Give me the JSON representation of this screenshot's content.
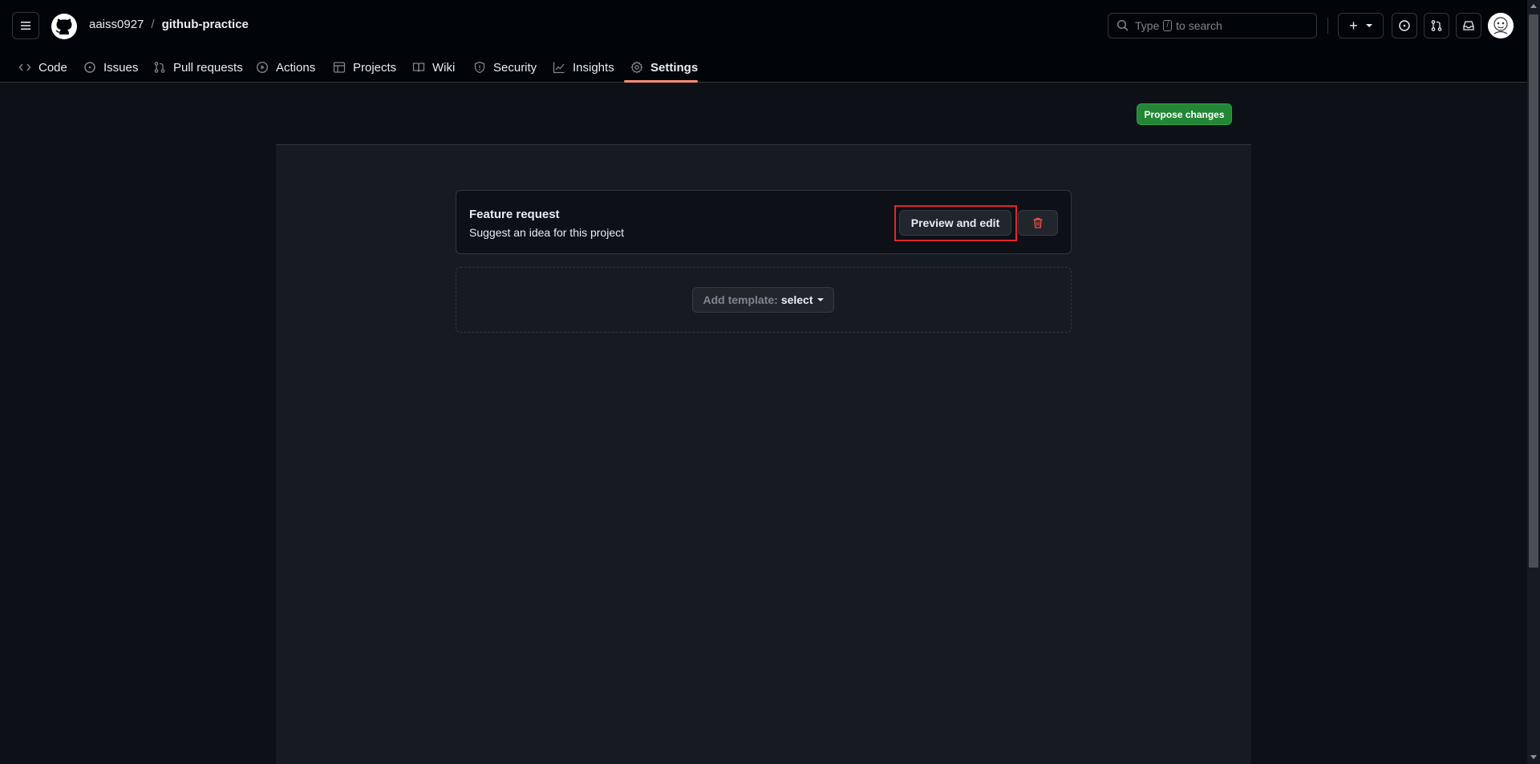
{
  "header": {
    "owner": "aaiss0927",
    "separator": "/",
    "repo": "github-practice",
    "search_before": "Type",
    "search_key": "/",
    "search_after": "to search",
    "create_label": "+"
  },
  "tabs": [
    {
      "label": "Code",
      "icon": "code-icon"
    },
    {
      "label": "Issues",
      "icon": "issue-opened-icon"
    },
    {
      "label": "Pull requests",
      "icon": "git-pull-request-icon"
    },
    {
      "label": "Actions",
      "icon": "play-icon"
    },
    {
      "label": "Projects",
      "icon": "table-icon"
    },
    {
      "label": "Wiki",
      "icon": "book-icon"
    },
    {
      "label": "Security",
      "icon": "shield-icon"
    },
    {
      "label": "Insights",
      "icon": "graph-icon"
    },
    {
      "label": "Settings",
      "icon": "gear-icon",
      "active": true
    }
  ],
  "main": {
    "propose_label": "Propose changes",
    "template": {
      "title": "Feature request",
      "description": "Suggest an idea for this project",
      "preview_label": "Preview and edit"
    },
    "add_template": {
      "label": "Add template:",
      "value": "select"
    }
  },
  "colors": {
    "accent_green": "#238636",
    "tab_underline": "#fd8c73",
    "highlight_border": "#e3262b",
    "danger": "#f85149"
  }
}
